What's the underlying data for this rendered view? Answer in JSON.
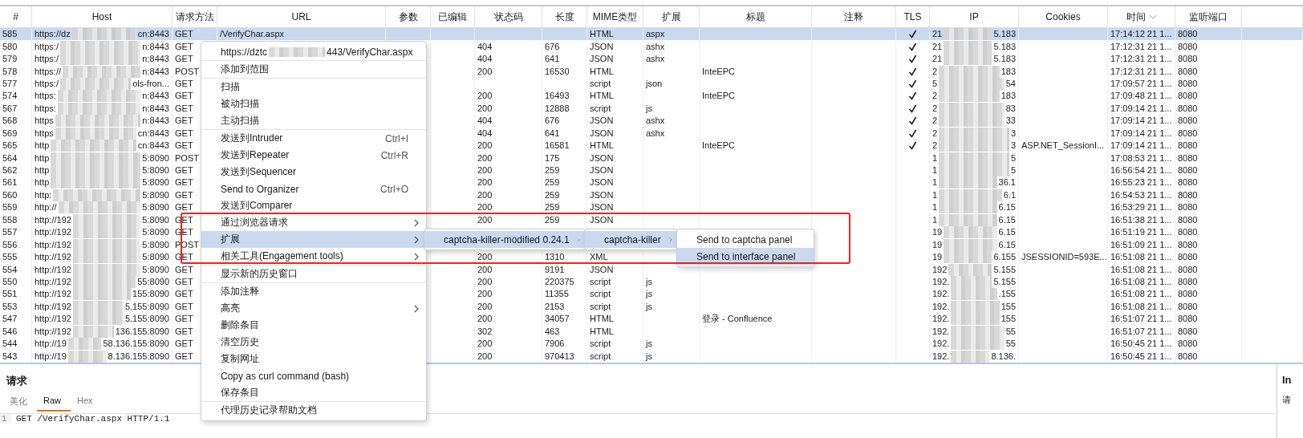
{
  "columns": [
    {
      "label": "#"
    },
    {
      "label": "Host"
    },
    {
      "label": "请求方法"
    },
    {
      "label": "URL"
    },
    {
      "label": "参数"
    },
    {
      "label": "已编辑"
    },
    {
      "label": "状态码"
    },
    {
      "label": "长度"
    },
    {
      "label": "MIME类型"
    },
    {
      "label": "扩展"
    },
    {
      "label": "标题"
    },
    {
      "label": "注释"
    },
    {
      "label": "TLS"
    },
    {
      "label": "IP"
    },
    {
      "label": "Cookies"
    },
    {
      "label": "时间",
      "sorted": true
    },
    {
      "label": "监听端口"
    }
  ],
  "rows": [
    {
      "num": "585",
      "host_start": "https://dz",
      "host_end": "cn:8443",
      "method": "GET",
      "url": "/VerifyChar.aspx",
      "mime": "HTML",
      "ext": "aspx",
      "tls": true,
      "ip_start": "21",
      "ip_end": "5.183",
      "time": "17:14:12 21 1...",
      "port": "8080",
      "selected": true
    },
    {
      "num": "580",
      "host_start": "https:/",
      "host_end": "n:8443",
      "method": "GET",
      "status": "404",
      "length": "676",
      "mime": "JSON",
      "ext": "ashx",
      "tls": true,
      "ip_start": "21",
      "ip_end": "5.183",
      "time": "17:12:31 21 1...",
      "port": "8080",
      "selected": false
    },
    {
      "num": "579",
      "host_start": "https:/",
      "host_end": "n:8443",
      "method": "GET",
      "status": "404",
      "length": "641",
      "mime": "JSON",
      "ext": "ashx",
      "tls": true,
      "ip_start": "21",
      "ip_end": "5.183",
      "time": "17:12:31 21 1...",
      "port": "8080",
      "selected": false
    },
    {
      "num": "578",
      "host_start": "https://",
      "host_end": "n:8443",
      "method": "POST",
      "status": "200",
      "length": "16530",
      "mime": "HTML",
      "title": "InteEPC",
      "tls": true,
      "ip_start": "2",
      "ip_end": "183",
      "time": "17:12:31 21 1...",
      "port": "8080",
      "selected": false
    },
    {
      "num": "577",
      "host_start": "https:/",
      "host_end": "ols-fron...",
      "method": "GET",
      "mime": "script",
      "ext": "json",
      "tls": true,
      "ip_start": "5",
      "ip_end": "54",
      "time": "17:09:57 21 1...",
      "port": "8080",
      "selected": false
    },
    {
      "num": "574",
      "host_start": "https:",
      "host_end": "n:8443",
      "method": "GET",
      "status": "200",
      "length": "16493",
      "mime": "HTML",
      "title": "InteEPC",
      "tls": true,
      "ip_start": "2",
      "ip_end": "183",
      "time": "17:09:48 21 1...",
      "port": "8080",
      "selected": false
    },
    {
      "num": "567",
      "host_start": "https:",
      "host_end": "n:8443",
      "method": "GET",
      "status": "200",
      "length": "12888",
      "mime": "script",
      "ext": "js",
      "tls": true,
      "ip_start": "2",
      "ip_end": "83",
      "time": "17:09:14 21 1...",
      "port": "8080",
      "selected": false
    },
    {
      "num": "568",
      "host_start": "https",
      "host_end": "n:8443",
      "method": "GET",
      "status": "404",
      "length": "676",
      "mime": "JSON",
      "ext": "ashx",
      "tls": true,
      "ip_start": "2",
      "ip_end": "33",
      "time": "17:09:14 21 1...",
      "port": "8080",
      "selected": false
    },
    {
      "num": "569",
      "host_start": "https",
      "host_end": "cn:8443",
      "method": "GET",
      "status": "404",
      "length": "641",
      "mime": "JSON",
      "ext": "ashx",
      "tls": true,
      "ip_start": "2",
      "ip_end": "3",
      "time": "17:09:14 21 1...",
      "port": "8080",
      "selected": false
    },
    {
      "num": "565",
      "host_start": "http",
      "host_end": "cn:8443",
      "method": "GET",
      "status": "200",
      "length": "16581",
      "mime": "HTML",
      "title": "InteEPC",
      "tls": true,
      "ip_start": "2",
      "ip_end": "3",
      "cookies": "ASP.NET_SessionI...",
      "time": "17:09:14 21 1...",
      "port": "8080",
      "selected": false
    },
    {
      "num": "564",
      "host_start": "http",
      "host_end": "5:8090",
      "method": "POST",
      "status": "200",
      "length": "175",
      "mime": "JSON",
      "tls": false,
      "ip_start": "1",
      "ip_end": "5",
      "time": "17:08:53 21 1...",
      "port": "8080",
      "selected": false
    },
    {
      "num": "562",
      "host_start": "http",
      "host_end": "5:8090",
      "method": "GET",
      "status": "200",
      "length": "259",
      "mime": "JSON",
      "tls": false,
      "ip_start": "1",
      "ip_end": "5",
      "time": "16:56:54 21 1...",
      "port": "8080",
      "selected": false
    },
    {
      "num": "561",
      "host_start": "http",
      "host_end": "5:8090",
      "method": "GET",
      "status": "200",
      "length": "259",
      "mime": "JSON",
      "tls": false,
      "ip_start": "1",
      "ip_end": "36.1",
      "time": "16:55:23 21 1...",
      "port": "8080",
      "selected": false
    },
    {
      "num": "560",
      "host_start": "http:",
      "host_end": "5:8090",
      "method": "GET",
      "status": "200",
      "length": "259",
      "mime": "JSON",
      "tls": false,
      "ip_start": "1",
      "ip_end": "6.1",
      "time": "16:54:53 21 1...",
      "port": "8080",
      "selected": false
    },
    {
      "num": "559",
      "host_start": "http://",
      "host_end": "5:8090",
      "method": "GET",
      "status": "200",
      "length": "259",
      "mime": "JSON",
      "tls": false,
      "ip_start": "1",
      "ip_end": "6.15",
      "time": "16:53:29 21 1...",
      "port": "8080",
      "selected": false
    },
    {
      "num": "558",
      "host_start": "http://192",
      "host_end": "5:8090",
      "method": "GET",
      "status": "200",
      "length": "259",
      "mime": "JSON",
      "tls": false,
      "ip_start": "1",
      "ip_end": "6.15",
      "time": "16:51:38 21 1...",
      "port": "8080",
      "selected": false
    },
    {
      "num": "557",
      "host_start": "http://192",
      "host_end": "5:8090",
      "method": "GET",
      "tls": false,
      "ip_start": "19",
      "ip_end": "6.15",
      "time": "16:51:19 21 1...",
      "port": "8080",
      "selected": false
    },
    {
      "num": "556",
      "host_start": "http://192",
      "host_end": "5:8090",
      "method": "POST",
      "tls": false,
      "ip_start": "19",
      "ip_end": "6.15",
      "time": "16:51:09 21 1...",
      "port": "8080",
      "selected": false
    },
    {
      "num": "555",
      "host_start": "http://192",
      "host_end": "5:8090",
      "method": "GET",
      "status": "200",
      "length": "1310",
      "mime": "XML",
      "tls": false,
      "ip_start": "19",
      "ip_end": "6.155",
      "cookies": "JSESSIONID=593E...",
      "time": "16:51:08 21 1...",
      "port": "8080",
      "selected": false
    },
    {
      "num": "554",
      "host_start": "http://192",
      "host_end": "5:8090",
      "method": "GET",
      "status": "200",
      "length": "9191",
      "mime": "JSON",
      "tls": false,
      "ip_start": "192",
      "ip_end": "5.155",
      "time": "16:51:08 21 1...",
      "port": "8080",
      "selected": false
    },
    {
      "num": "550",
      "host_start": "http://192",
      "host_end": "55:8090",
      "method": "GET",
      "status": "200",
      "length": "220375",
      "mime": "script",
      "ext": "js",
      "tls": false,
      "ip_start": "192.",
      "ip_end": "5.155",
      "time": "16:51:08 21 1...",
      "port": "8080",
      "selected": false
    },
    {
      "num": "551",
      "host_start": "http://192",
      "host_end": "155:8090",
      "method": "GET",
      "status": "200",
      "length": "11355",
      "mime": "script",
      "ext": "js",
      "tls": false,
      "ip_start": "192.",
      "ip_end": ".155",
      "time": "16:51:08 21 1...",
      "port": "8080",
      "selected": false
    },
    {
      "num": "553",
      "host_start": "http://192",
      "host_end": "5.155:8090",
      "method": "GET",
      "status": "200",
      "length": "2153",
      "mime": "script",
      "ext": "js",
      "tls": false,
      "ip_start": "192.",
      "ip_end": "155",
      "time": "16:51:08 21 1...",
      "port": "8080",
      "selected": false
    },
    {
      "num": "547",
      "host_start": "http://192",
      "host_end": "5.155:8090",
      "method": "GET",
      "status": "200",
      "length": "34057",
      "mime": "HTML",
      "title": "登录 - Confluence",
      "tls": false,
      "ip_start": "192.",
      "ip_end": "155",
      "time": "16:51:07 21 1...",
      "port": "8080",
      "selected": false
    },
    {
      "num": "546",
      "host_start": "http://192",
      "host_end": "136.155:8090",
      "method": "GET",
      "status": "302",
      "length": "463",
      "mime": "HTML",
      "tls": false,
      "ip_start": "192.",
      "ip_end": "55",
      "time": "16:51:07 21 1...",
      "port": "8080",
      "selected": false
    },
    {
      "num": "544",
      "host_start": "http://19",
      "host_end": "58.136.155:8090",
      "method": "GET",
      "status": "200",
      "length": "7906",
      "mime": "script",
      "ext": "js",
      "tls": false,
      "ip_start": "192.",
      "ip_end": "55",
      "time": "16:50:45 21 1...",
      "port": "8080",
      "selected": false
    },
    {
      "num": "543",
      "host_start": "http://19",
      "host_end": "8.136.155:8090",
      "method": "GET",
      "status": "200",
      "length": "970413",
      "mime": "script",
      "ext": "js",
      "tls": false,
      "ip_start": "192.",
      "ip_end": "8.136.",
      "time": "16:50:45 21 1...",
      "port": "8080",
      "selected": false
    }
  ],
  "context_menu": {
    "groups": [
      [
        {
          "kind": "redacted",
          "label_start": "https://dztc",
          "label_end": "443/VerifyChar.aspx",
          "has_submenu": false,
          "selected": false
        }
      ],
      [
        {
          "kind": "item",
          "label": "添加到范围",
          "has_submenu": false,
          "selected": false
        }
      ],
      [
        {
          "kind": "item",
          "label": "扫描",
          "has_submenu": false,
          "selected": false
        },
        {
          "kind": "item",
          "label": "被动扫描",
          "has_submenu": false,
          "selected": false
        },
        {
          "kind": "item",
          "label": "主动扫描",
          "has_submenu": false,
          "selected": false
        }
      ],
      [
        {
          "kind": "item",
          "label": "发送到Intruder",
          "shortcut": "Ctrl+I",
          "has_submenu": false,
          "selected": false
        },
        {
          "kind": "item",
          "label": "发送到Repeater",
          "shortcut": "Ctrl+R",
          "has_submenu": false,
          "selected": false
        },
        {
          "kind": "item",
          "label": "发送到Sequencer",
          "has_submenu": false,
          "selected": false
        },
        {
          "kind": "item",
          "label": "Send to Organizer",
          "shortcut": "Ctrl+O",
          "has_submenu": false,
          "selected": false
        },
        {
          "kind": "item",
          "label": "发送到Comparer",
          "has_submenu": false,
          "selected": false
        },
        {
          "kind": "item",
          "label": "通过浏览器请求",
          "has_submenu": true,
          "selected": false
        },
        {
          "kind": "item",
          "label": "扩展",
          "has_submenu": true,
          "selected": true
        },
        {
          "kind": "item",
          "label": "相关工具(Engagement tools)",
          "has_submenu": true,
          "selected": false
        }
      ],
      [
        {
          "kind": "item",
          "label": "显示新的历史窗口",
          "has_submenu": false,
          "selected": false
        }
      ],
      [
        {
          "kind": "item",
          "label": "添加注释",
          "has_submenu": false,
          "selected": false
        },
        {
          "kind": "item",
          "label": "高亮",
          "has_submenu": true,
          "selected": false
        },
        {
          "kind": "item",
          "label": "删除条目",
          "has_submenu": false,
          "selected": false
        },
        {
          "kind": "item",
          "label": "清空历史",
          "has_submenu": false,
          "selected": false
        },
        {
          "kind": "item",
          "label": "复制网址",
          "has_submenu": false,
          "selected": false
        },
        {
          "kind": "item",
          "label": "Copy as curl command (bash)",
          "has_submenu": false,
          "selected": false
        },
        {
          "kind": "item",
          "label": "保存条目",
          "has_submenu": false,
          "selected": false
        }
      ],
      [
        {
          "kind": "item",
          "label": "代理历史记录帮助文档",
          "has_submenu": false,
          "selected": false
        }
      ]
    ]
  },
  "submenus": [
    {
      "items": [
        {
          "label": "captcha-killer-modified 0.24.1",
          "has_submenu": true,
          "selected": true
        }
      ]
    },
    {
      "items": [
        {
          "label": "captcha-killer",
          "has_submenu": true,
          "selected": true
        }
      ]
    },
    {
      "items": [
        {
          "label": "Send to captcha panel",
          "has_submenu": false,
          "selected": false
        },
        {
          "label": "Send to interface panel",
          "has_submenu": false,
          "selected": true
        }
      ]
    }
  ],
  "request_panel": {
    "title": "请求",
    "tabs": [
      {
        "label": "美化",
        "selected": false
      },
      {
        "label": "Raw",
        "selected": true
      },
      {
        "label": "Hex",
        "selected": false
      }
    ],
    "lines": [
      {
        "number": "1",
        "text": "GET /VerifyChar.aspx HTTP/1.1"
      }
    ]
  },
  "side_panel": {
    "title": "In",
    "text": "请"
  }
}
